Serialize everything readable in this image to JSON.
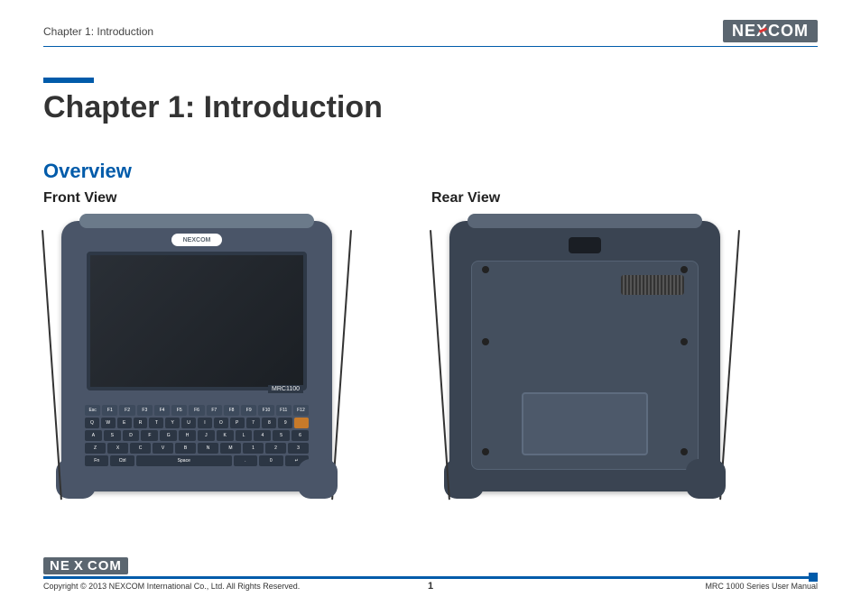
{
  "header": {
    "label": "Chapter 1: Introduction",
    "brand": "NEXCOM"
  },
  "title": "Chapter 1: Introduction",
  "section": "Overview",
  "columns": {
    "front": {
      "heading": "Front View",
      "device_badge": "NEXCOM",
      "device_model": "MRC1100"
    },
    "rear": {
      "heading": "Rear View"
    }
  },
  "keyboard": {
    "row_fn": [
      "Esc",
      "F1",
      "F2",
      "F3",
      "F4",
      "F5",
      "F6",
      "F7",
      "F8",
      "F9",
      "F10",
      "F11",
      "F12"
    ],
    "row1": [
      "Q",
      "W",
      "E",
      "R",
      "T",
      "Y",
      "U",
      "I",
      "O",
      "P",
      "7",
      "8",
      "9"
    ],
    "row2": [
      "A",
      "S",
      "D",
      "F",
      "G",
      "H",
      "J",
      "K",
      "L",
      "4",
      "5",
      "6"
    ],
    "row3": [
      "Z",
      "X",
      "C",
      "V",
      "B",
      "N",
      "M",
      "1",
      "2",
      "3"
    ],
    "row4": [
      "Fn",
      "Ctrl",
      "Space",
      ".",
      "0",
      "↵"
    ]
  },
  "footer": {
    "brand": "NEXCOM",
    "copyright": "Copyright © 2013 NEXCOM International Co., Ltd. All Rights Reserved.",
    "page": "1",
    "manual": "MRC 1000 Series User Manual"
  }
}
